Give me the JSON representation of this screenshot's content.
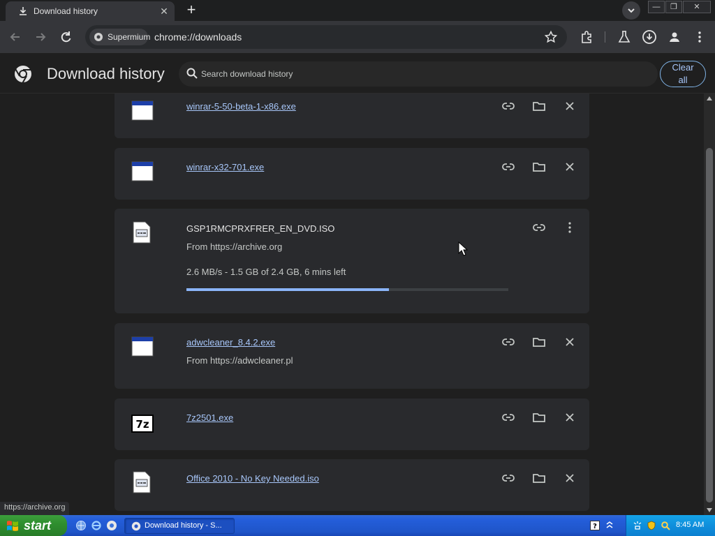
{
  "tab": {
    "title": "Download history",
    "close_glyph": "✕"
  },
  "window_controls": {
    "minimize": "—",
    "restore": "❐",
    "close": "✕"
  },
  "toolbar": {
    "site_chip": "Supermium",
    "url": "chrome://downloads"
  },
  "header": {
    "title": "Download history",
    "search_placeholder": "Search download history",
    "clear_all_line1": "Clear",
    "clear_all_line2": "all"
  },
  "downloads": [
    {
      "name": "winrar-5-50-beta-1-x86.exe",
      "icon": "exe-window-icon"
    },
    {
      "name": "winrar-x32-701.exe",
      "icon": "exe-window-icon"
    },
    {
      "name": "GSP1RMCPRXFRER_EN_DVD.ISO",
      "icon": "iso-file-icon",
      "source": "From https://archive.org",
      "progress_text": "2.6 MB/s - 1.5 GB of 2.4 GB, 6 mins left",
      "progress_fraction": 0.63
    },
    {
      "name": "adwcleaner_8.4.2.exe",
      "icon": "exe-window-icon",
      "source": "From https://adwcleaner.pl"
    },
    {
      "name": "7z2501.exe",
      "icon": "7zip-icon"
    },
    {
      "name": "Office 2010 - No Key Needed.iso",
      "icon": "iso-file-icon"
    }
  ],
  "status_url": "https://archive.org",
  "taskbar": {
    "start_label": "start",
    "task_label": "Download history - S...",
    "clock": "8:45 AM"
  },
  "colors": {
    "accent": "#a8c7fa",
    "progress": "#8ab4f8",
    "card": "#292a2d",
    "background": "#1f1f1f"
  }
}
